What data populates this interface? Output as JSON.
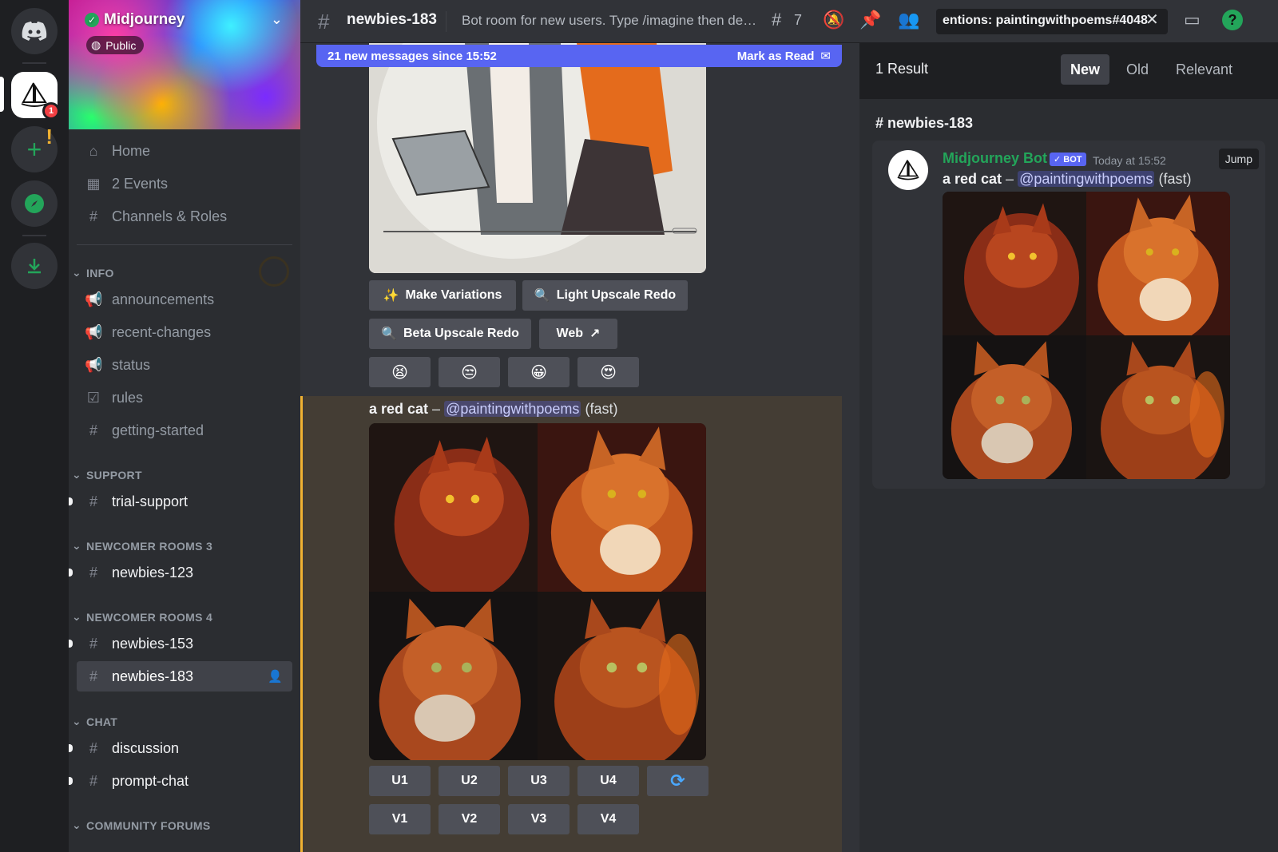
{
  "server": {
    "name": "Midjourney",
    "visibility": "Public",
    "notification_count": "1"
  },
  "sidebar": {
    "nav": [
      {
        "label": "Home",
        "icon": "home-icon"
      },
      {
        "label": "2 Events",
        "icon": "calendar-icon"
      },
      {
        "label": "Channels & Roles",
        "icon": "channel-browse-icon"
      }
    ],
    "categories": {
      "info": "INFO",
      "support": "SUPPORT",
      "newcomer3": "NEWCOMER ROOMS 3",
      "newcomer4": "NEWCOMER ROOMS 4",
      "chat": "CHAT",
      "forums": "COMMUNITY FORUMS"
    },
    "info_channels": [
      "announcements",
      "recent-changes",
      "status",
      "rules",
      "getting-started"
    ],
    "support_channels": [
      "trial-support"
    ],
    "newcomer3_channels": [
      "newbies-123"
    ],
    "newcomer4_channels": [
      "newbies-153",
      "newbies-183"
    ],
    "chat_channels": [
      "discussion",
      "prompt-chat"
    ]
  },
  "header": {
    "channel_name": "newbies-183",
    "topic": "Bot room for new users. Type /imagine then describe what you want to draw.",
    "threads_count": "7",
    "search_value": "entions: paintingwithpoems#4048"
  },
  "chat": {
    "new_messages": "21 new messages since 15:52",
    "mark_as_read": "Mark as Read",
    "buttons_row1": [
      "Make Variations",
      "Light Upscale Redo"
    ],
    "buttons_row2": [
      "Beta Upscale Redo",
      "Web"
    ],
    "reactions": [
      "😫",
      "😒",
      "😀",
      "😍"
    ],
    "message": {
      "prompt": "a red cat",
      "dash": " – ",
      "mention": "@paintingwithpoems",
      "speed": "(fast)"
    },
    "upscale_buttons": [
      "U1",
      "U2",
      "U3",
      "U4"
    ],
    "variation_buttons": [
      "V1",
      "V2",
      "V3",
      "V4"
    ],
    "reroll_icon": "refresh-icon"
  },
  "results": {
    "count": "1 Result",
    "tabs": [
      "New",
      "Old",
      "Relevant"
    ],
    "active_tab": "New",
    "channel": "newbies-183",
    "author": "Midjourney Bot",
    "bot_tag": "✓ BOT",
    "timestamp": "Today at 15:52",
    "jump": "Jump",
    "message": {
      "prompt": "a red cat",
      "dash": " – ",
      "mention": "@paintingwithpoems",
      "speed": "(fast)"
    }
  },
  "colors": {
    "accent": "#5865f2",
    "highlight": "#f0b232",
    "online": "#23a55a"
  }
}
